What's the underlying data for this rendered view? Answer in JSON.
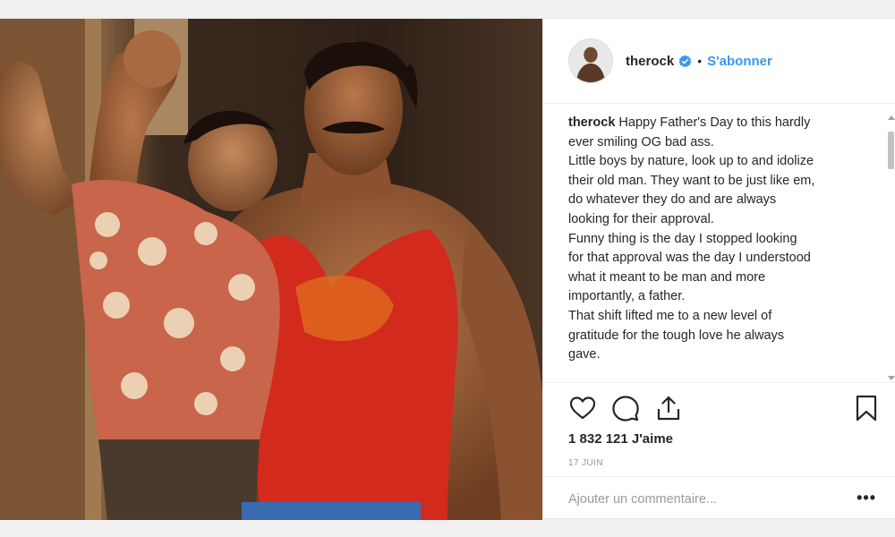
{
  "post": {
    "username": "therock",
    "separator": "•",
    "follow_label": "S'abonner",
    "caption_lines": [
      "Happy Father's Day to this hardly",
      "ever smiling OG bad ass.",
      "Little boys by nature, look up to and idolize",
      "their old man. They want to be just like em,",
      "do whatever they do and are always",
      "looking for their approval.",
      "Funny thing is the day I stopped looking",
      "for that approval was the day I understood",
      "what it meant to be man and more",
      "importantly, a father.",
      "That shift lifted me to a new level of",
      "gratitude for the tough love he always",
      "gave."
    ],
    "likes": "1 832 121 J'aime",
    "date": "17 JUIN",
    "comment_placeholder": "Ajouter un commentaire...",
    "more_label": "•••"
  },
  "icons": {
    "verified": "verified-badge-icon",
    "like": "heart-icon",
    "comment": "speech-bubble-icon",
    "share": "share-icon",
    "save": "bookmark-icon"
  },
  "colors": {
    "accent": "#3897f0",
    "text": "#262626",
    "muted": "#999999",
    "border": "#efefef"
  }
}
